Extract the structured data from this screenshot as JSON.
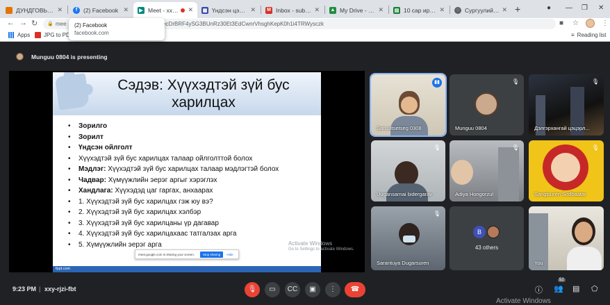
{
  "browser": {
    "tabs": [
      {
        "label": "ДУНДГОВЬ АЙМАГ",
        "icon": "page-icon",
        "color": "#e37400"
      },
      {
        "label": "(2) Facebook",
        "icon": "facebook-icon",
        "color": "#1877f2"
      },
      {
        "label": "Meet - xxy-rjzi-fbt",
        "icon": "meet-icon",
        "color": "#00897b"
      },
      {
        "label": "Үндсэн цэс | emon",
        "icon": "grid-icon",
        "color": "#3949ab"
      },
      {
        "label": "Inbox - sub.dundgo",
        "icon": "gmail-icon",
        "color": "#d93025"
      },
      {
        "label": "My Drive - Google D",
        "icon": "drive-icon",
        "color": "#1e8e3e"
      },
      {
        "label": "10 сар ирц БШУГ",
        "icon": "sheets-icon",
        "color": "#188038"
      },
      {
        "label": "Сургуулийн өмнөх б",
        "icon": "globe-icon",
        "color": "#5f6368"
      }
    ],
    "url": "meet.google.com/xxy-rjzi-fbt?authuser=0&hs=122&pli=1&ijlm=AKQLtecDrBRF4ySG3BUnRz30Et3EdCwnrVhsghKepK0h1i4TRWysczk",
    "url_visible": "AKQLtecDrBRF4ySG3BUnRz30Et3EdCwnrVhsghKepK0h1i4TRWysczk",
    "url_prefix": "mee",
    "bookmarks": {
      "apps": "Apps",
      "jpg": "JPG to PDF"
    },
    "reading_list": "Reading list",
    "tooltip": {
      "title": "(2) Facebook",
      "sub": "facebook.com"
    }
  },
  "meet": {
    "presenting": "Munguu 0804 is presenting",
    "slide": {
      "title_line1": "Сэдэв: Хүүхэдтэй зүй бус",
      "title_line2": "харилцах",
      "items": [
        {
          "b": "Зорилго",
          "t": ""
        },
        {
          "b": "Зорилт",
          "t": ""
        },
        {
          "b": "Үндсэн ойлголт",
          "t": ""
        },
        {
          "b": "",
          "t": "Хүүхэдтэй зүй бус харилцах талаар ойлголттой болох"
        },
        {
          "b": "Мэдлэг:",
          "t": " Хүүхэдтэй зүй бус харилцах талаар мэдлэгтэй болох"
        },
        {
          "b": "Чадвар:",
          "t": " Хүмүүжлийн эерэг аргыг хэрэглэх"
        },
        {
          "b": "Хандлага:",
          "t": " Хүүхэдэд цаг гаргах, анхаарах"
        },
        {
          "b": "",
          "t": "1. Хүүхэдтэй зүй бус харилцах гэж юу вэ?"
        },
        {
          "b": "",
          "t": "2. Хүүхэдтэй зүй бус харилцах хэлбэр"
        },
        {
          "b": "",
          "t": "3. Хүүхэдтэй зүй бус харилцаны үр дагавар"
        },
        {
          "b": "",
          "t": "4. Хүүхэдтэй зүй бус харилцахаас татгалзах арга"
        },
        {
          "b": "",
          "t": "5. Хүмүүжлийн эерэг арга"
        }
      ],
      "footer": "fppt.com",
      "share_notice": "meet.google.com is sharing your screen.",
      "stop_sharing": "Stop sharing",
      "hide": "Hide",
      "activate_title": "Activate Windows",
      "activate_sub": "Go to Settings to activate Windows."
    },
    "participants": [
      {
        "name": "Saruultsetseg 0308"
      },
      {
        "name": "Munguu 0804"
      },
      {
        "name": "Дэлгэрхангай цэцэрл..."
      },
      {
        "name": "Uugansarnai bidergarav"
      },
      {
        "name": "Adiya Hongorzul"
      },
      {
        "name": "Sangisuren Sodbaatar"
      },
      {
        "name": "Sarantuya Dugarsuren"
      },
      {
        "name": "43 others",
        "avatar_letter": "B"
      },
      {
        "name": "You"
      }
    ],
    "time": "9:23 PM",
    "meeting_code": "xxy-rjzi-fbt",
    "people_count": "52",
    "activate_windows": "Activate Windows"
  },
  "colors": {
    "meet_bg": "#202124",
    "tile_bg": "#3c4043",
    "hangup": "#ea4335",
    "accent": "#1a73e8",
    "slide_blue": "#2b65b5"
  }
}
